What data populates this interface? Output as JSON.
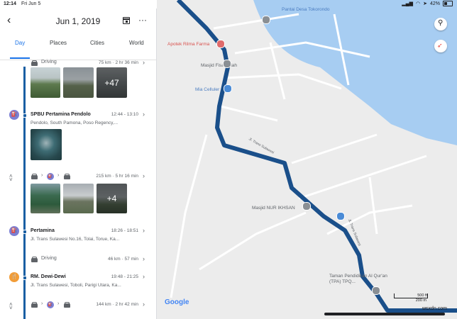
{
  "status": {
    "time": "12:14",
    "date": "Fri Jun 5",
    "battery": "42%"
  },
  "header": {
    "date": "Jun 1, 2019"
  },
  "tabs": [
    {
      "label": "Day",
      "active": true
    },
    {
      "label": "Places",
      "active": false
    },
    {
      "label": "Cities",
      "active": false
    },
    {
      "label": "World",
      "active": false
    }
  ],
  "timeline": {
    "drive1": {
      "title": "Driving",
      "meta": "75 km · 2 hr 36 min",
      "more_photos": "+47"
    },
    "stop1": {
      "title": "SPBU Pertamina Pendolo",
      "time": "12:44 - 13:10",
      "address": "Pendolo, South Pamona, Poso Regency,..."
    },
    "trip1": {
      "meta": "215 km · 5 hr 16 min",
      "more_photos": "+4"
    },
    "stop2": {
      "title": "Pertamina",
      "time": "18:26 - 18:51",
      "address": "Jl. Trans Sulawesi No.16, Tolai, Torue, Ka..."
    },
    "drive2": {
      "title": "Driving",
      "meta": "46 km · 57 min"
    },
    "stop3": {
      "title": "RM. Dewi-Dewi",
      "time": "19:48 - 21:25",
      "address": "Jl. Trans Sulawesi, Toboli, Parigi Utara, Ka..."
    },
    "trip2": {
      "meta": "144 km · 2 hr 42 min"
    }
  },
  "map": {
    "labels": {
      "pantai": "Pantai Desa Tokorondo",
      "apotek": "Apotek Rilma Farma",
      "masjid1": "Masjid Fisabilillah",
      "mia": "Mia Celluler",
      "masjid2": "Masjid NUR IKHSAN",
      "taman": "Taman Pendidikan Al Qur'an (TPA) TPQ...",
      "road1": "Jl. Trans Sulawesi",
      "road2": "Jl. Trans Sulawesi"
    },
    "logo": "Google",
    "scale_ft": "500 ft",
    "scale_m": "200 m",
    "watermark": "wsxdn.com"
  },
  "colors": {
    "route": "#1a4f8a",
    "accent": "#1a73e8",
    "water": "#a7cdf2",
    "land": "#ececec"
  }
}
